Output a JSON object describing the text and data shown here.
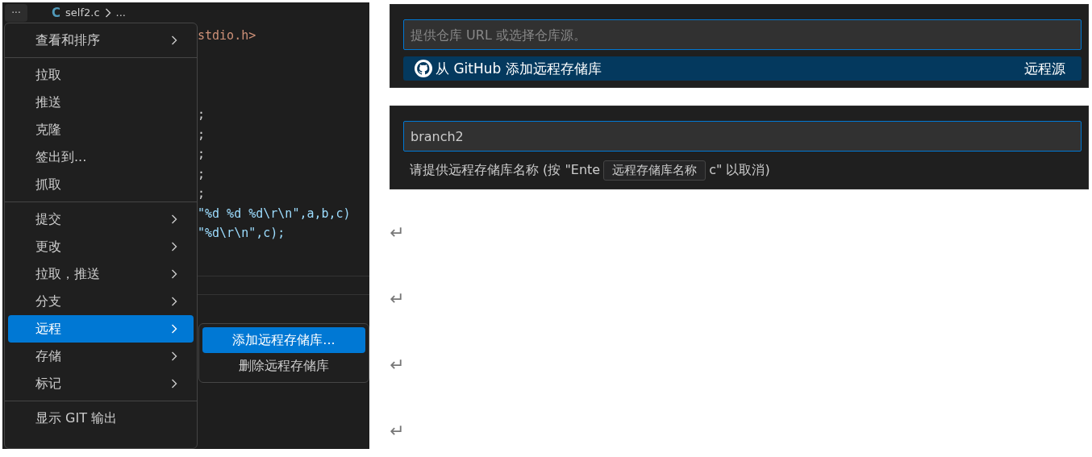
{
  "editor": {
    "more_button": "···",
    "breadcrumb": {
      "lang": "C",
      "file": "self2.c",
      "tail": "..."
    },
    "code_lines": [
      {
        "kind": "include",
        "text": "stdio.h>"
      },
      {
        "kind": "blank"
      },
      {
        "kind": "blank"
      },
      {
        "kind": "blank"
      },
      {
        "kind": "plain",
        "text": ";"
      },
      {
        "kind": "plain",
        "text": ";"
      },
      {
        "kind": "plain",
        "text": ";"
      },
      {
        "kind": "plain",
        "text": ";"
      },
      {
        "kind": "plain",
        "text": ";"
      },
      {
        "kind": "call",
        "text": "\"%d %d %d\\r\\n\",a,b,c)"
      },
      {
        "kind": "call",
        "text": "\"%d\\r\\n\",c);"
      }
    ]
  },
  "menu": {
    "groups": [
      [
        {
          "label": "查看和排序",
          "has_submenu": true,
          "selected": false
        }
      ],
      [
        {
          "label": "拉取",
          "has_submenu": false,
          "selected": false
        },
        {
          "label": "推送",
          "has_submenu": false,
          "selected": false
        },
        {
          "label": "克隆",
          "has_submenu": false,
          "selected": false
        },
        {
          "label": "签出到...",
          "has_submenu": false,
          "selected": false
        },
        {
          "label": "抓取",
          "has_submenu": false,
          "selected": false
        }
      ],
      [
        {
          "label": "提交",
          "has_submenu": true,
          "selected": false
        },
        {
          "label": "更改",
          "has_submenu": true,
          "selected": false
        },
        {
          "label": "拉取，推送",
          "has_submenu": true,
          "selected": false
        },
        {
          "label": "分支",
          "has_submenu": true,
          "selected": false
        },
        {
          "label": "远程",
          "has_submenu": true,
          "selected": true
        },
        {
          "label": "存储",
          "has_submenu": true,
          "selected": false
        },
        {
          "label": "标记",
          "has_submenu": true,
          "selected": false
        }
      ],
      [
        {
          "label": "显示 GIT 输出",
          "has_submenu": false,
          "selected": false
        }
      ]
    ],
    "submenu": [
      {
        "label": "添加远程存储库...",
        "selected": true
      },
      {
        "label": "删除远程存储库",
        "selected": false
      }
    ]
  },
  "add_remote_picker": {
    "placeholder": "提供仓库 URL 或选择仓库源。",
    "option": {
      "label": "从 GitHub 添加远程存储库",
      "detail": "远程源",
      "selected": true
    }
  },
  "name_picker": {
    "value": "branch2",
    "hint_before": "请提供远程存储库名称 (按 \"Ente",
    "tooltip": "远程存储库名称",
    "hint_after": "c\" 以取消)"
  },
  "paragraph_marks": [
    "↵",
    "↵",
    "↵",
    "↵"
  ]
}
